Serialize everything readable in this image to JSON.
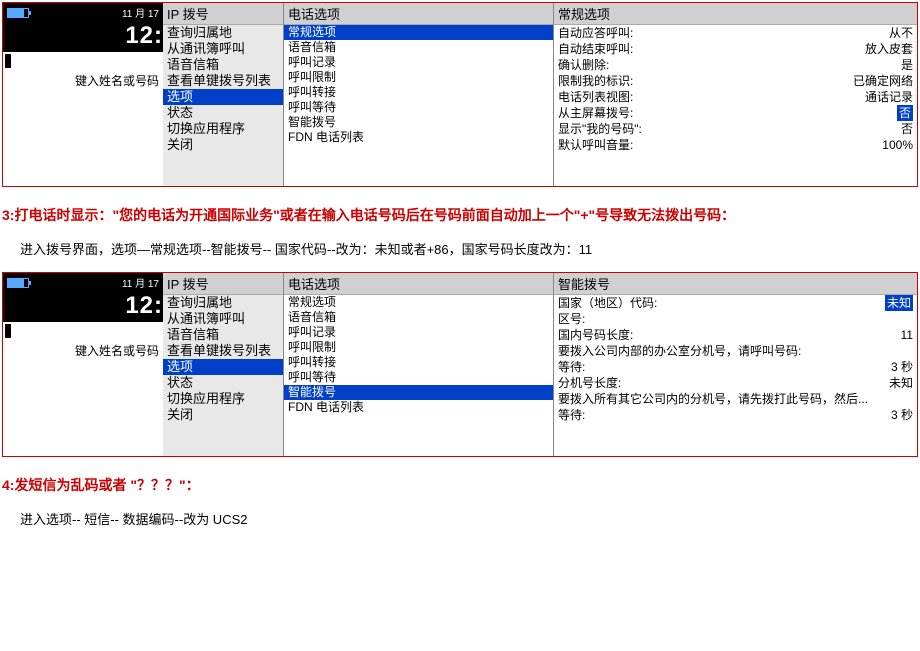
{
  "shot1": {
    "phone": {
      "date": "11 月 17",
      "clock": "12:",
      "label": "键入姓名或号码"
    },
    "menu": {
      "header": "IP 拨号",
      "items": [
        "查询归属地",
        "从通讯簿呼叫",
        "语音信箱",
        "查看单键拨号列表",
        "选项",
        "状态",
        "切换应用程序",
        "关闭"
      ],
      "selected": 4
    },
    "options": {
      "header": "电话选项",
      "items": [
        "常规选项",
        "语音信箱",
        "呼叫记录",
        "呼叫限制",
        "呼叫转接",
        "呼叫等待",
        "智能拨号",
        "FDN 电话列表"
      ],
      "selected": 0
    },
    "settings": {
      "header": "常规选项",
      "rows": [
        {
          "label": "自动应答呼叫:",
          "value": "从不"
        },
        {
          "label": "自动结束呼叫:",
          "value": "放入皮套"
        },
        {
          "label": "确认删除:",
          "value": "是"
        },
        {
          "label": "限制我的标识:",
          "value": "已确定网络"
        },
        {
          "label": "电话列表视图:",
          "value": "通话记录"
        },
        {
          "label": "从主屏幕拨号:",
          "value": "否",
          "hl": true
        },
        {
          "label": "显示\"我的号码\":",
          "value": "否"
        },
        {
          "label": "默认呼叫音量:",
          "value": "100%"
        }
      ]
    }
  },
  "instr1_red": "3:打电话时显示：\"您的电话为开通国际业务\"或者在输入电话号码后在号码前面自动加上一个\"+\"号导致无法拨出号码：",
  "instr1_black": "进入拨号界面，选项—常规选项--智能拨号-- 国家代码--改为：未知或者+86，国家号码长度改为：11",
  "shot2": {
    "phone": {
      "date": "11 月 17",
      "clock": "12:",
      "label": "键入姓名或号码"
    },
    "menu": {
      "header": "IP 拨号",
      "items": [
        "查询归属地",
        "从通讯簿呼叫",
        "语音信箱",
        "查看单键拨号列表",
        "选项",
        "状态",
        "切换应用程序",
        "关闭"
      ],
      "selected": 4
    },
    "options": {
      "header": "电话选项",
      "items": [
        "常规选项",
        "语音信箱",
        "呼叫记录",
        "呼叫限制",
        "呼叫转接",
        "呼叫等待",
        "智能拨号",
        "FDN 电话列表"
      ],
      "selected": 6
    },
    "settings": {
      "header": "智能拨号",
      "rows1": [
        {
          "label": "国家（地区）代码:",
          "value": "未知",
          "hl": true
        },
        {
          "label": "区号:",
          "value": ""
        },
        {
          "label": "国内号码长度:",
          "value": "11"
        }
      ],
      "text1": "要拨入公司内部的办公室分机号，请呼叫号码:",
      "rows2": [
        {
          "label": "等待:",
          "value": "3 秒"
        },
        {
          "label": "分机号长度:",
          "value": "未知"
        }
      ],
      "text2": "要拨入所有其它公司内的分机号，请先拨打此号码，然后...",
      "rows3": [
        {
          "label": "等待:",
          "value": "3 秒"
        }
      ]
    }
  },
  "instr2_red": "4:发短信为乱码或者 \"？？？\"：",
  "instr2_black": "进入选项-- 短信-- 数据编码--改为 UCS2"
}
